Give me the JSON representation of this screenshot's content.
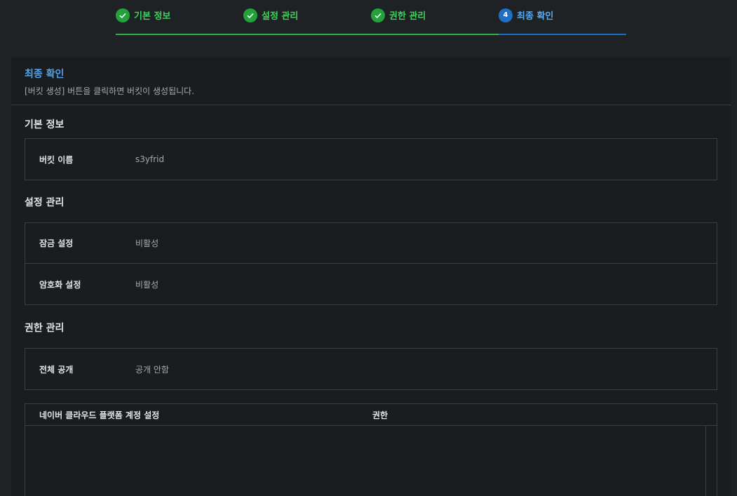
{
  "stepper": {
    "steps": [
      {
        "label": "기본 정보",
        "state": "done"
      },
      {
        "label": "설정 관리",
        "state": "done"
      },
      {
        "label": "권한 관리",
        "state": "done"
      },
      {
        "label": "최종 확인",
        "state": "active",
        "number": "4"
      }
    ],
    "colors": {
      "done": "#2fb344",
      "active": "#1f6fc6"
    }
  },
  "panel": {
    "title": "최종 확인",
    "description": "[버킷 생성] 버튼을 클릭하면 버킷이 생성됩니다."
  },
  "basic_info": {
    "title": "기본 정보",
    "rows": [
      {
        "label": "버킷 이름",
        "value": "s3yfrid"
      }
    ]
  },
  "settings": {
    "title": "설정 관리",
    "rows": [
      {
        "label": "잠금 설정",
        "value": "비활성"
      },
      {
        "label": "암호화 설정",
        "value": "비활성"
      }
    ]
  },
  "permissions": {
    "title": "권한 관리",
    "rows": [
      {
        "label": "전체 공개",
        "value": "공개 안함"
      }
    ],
    "table": {
      "columns": [
        "네이버 클라우드 플랫폼 계정 설정",
        "권한"
      ]
    }
  }
}
